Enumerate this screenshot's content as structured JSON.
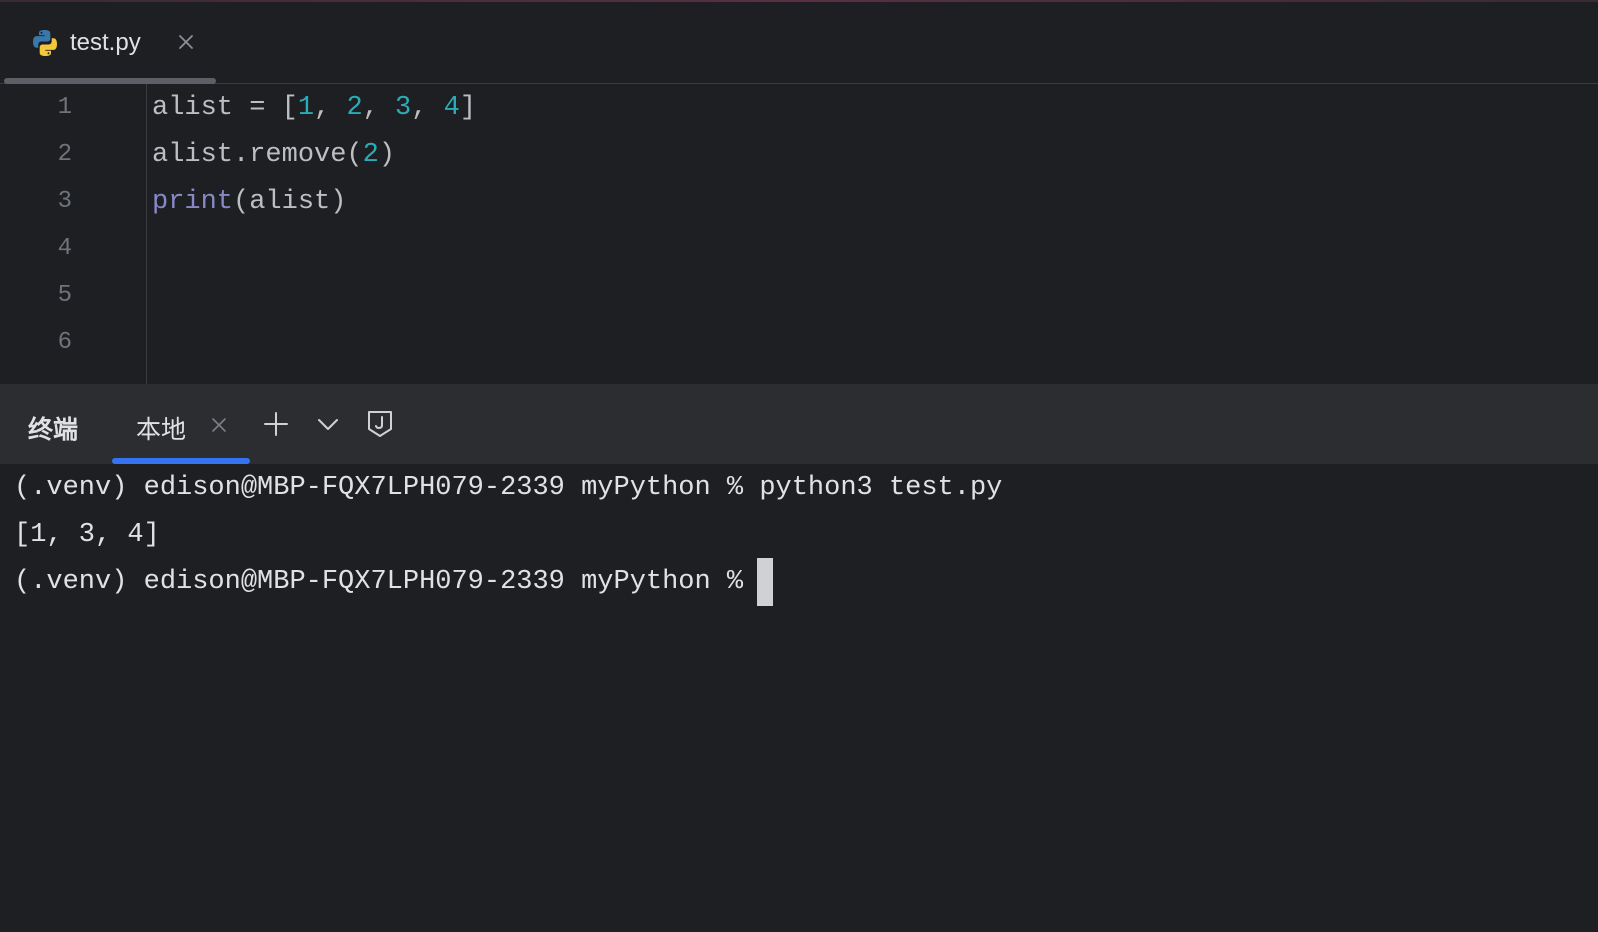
{
  "editor_tab": {
    "filename": "test.py",
    "icon": "python-icon"
  },
  "editor": {
    "line_numbers": [
      "1",
      "2",
      "3",
      "4",
      "5",
      "6"
    ],
    "code_lines": [
      {
        "tokens": [
          {
            "text": "alist = [",
            "type": "plain"
          },
          {
            "text": "1",
            "type": "num"
          },
          {
            "text": ", ",
            "type": "plain"
          },
          {
            "text": "2",
            "type": "num"
          },
          {
            "text": ", ",
            "type": "plain"
          },
          {
            "text": "3",
            "type": "num"
          },
          {
            "text": ", ",
            "type": "plain"
          },
          {
            "text": "4",
            "type": "num"
          },
          {
            "text": "]",
            "type": "plain"
          }
        ]
      },
      {
        "tokens": [
          {
            "text": "alist.remove(",
            "type": "plain"
          },
          {
            "text": "2",
            "type": "num"
          },
          {
            "text": ")",
            "type": "plain"
          }
        ]
      },
      {
        "tokens": [
          {
            "text": "print",
            "type": "builtin"
          },
          {
            "text": "(alist)",
            "type": "plain"
          }
        ]
      }
    ]
  },
  "terminal": {
    "title": "终端",
    "tab_label": "本地",
    "lines": [
      "(.venv) edison@MBP-FQX7LPH079-2339 myPython % python3 test.py",
      "[1, 3, 4]",
      "(.venv) edison@MBP-FQX7LPH079-2339 myPython %"
    ]
  },
  "colors": {
    "background": "#1e1f22",
    "panel_header": "#2b2d30",
    "number_token": "#2aacb8",
    "builtin_token": "#8888c6",
    "active_tab_underline": "#3574f0"
  }
}
